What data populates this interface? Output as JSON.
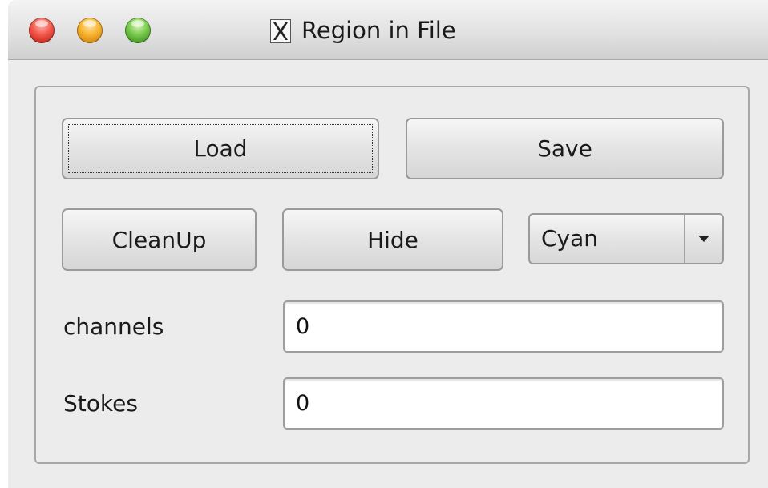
{
  "window": {
    "title": "Region in File"
  },
  "buttons": {
    "load": "Load",
    "save": "Save",
    "cleanup": "CleanUp",
    "hide": "Hide"
  },
  "color_select": {
    "selected": "Cyan"
  },
  "fields": {
    "channels": {
      "label": "channels",
      "value": "0"
    },
    "stokes": {
      "label": "Stokes",
      "value": "0"
    }
  },
  "icons": {
    "close": "close-traffic-light-icon",
    "minimize": "minimize-traffic-light-icon",
    "zoom": "zoom-traffic-light-icon",
    "app": "x11-icon",
    "dropdown": "chevron-down-icon"
  },
  "colors": {
    "window_bg": "#ececec",
    "close": "#f2564a",
    "minimize": "#f7b22e",
    "zoom": "#76c84a"
  }
}
